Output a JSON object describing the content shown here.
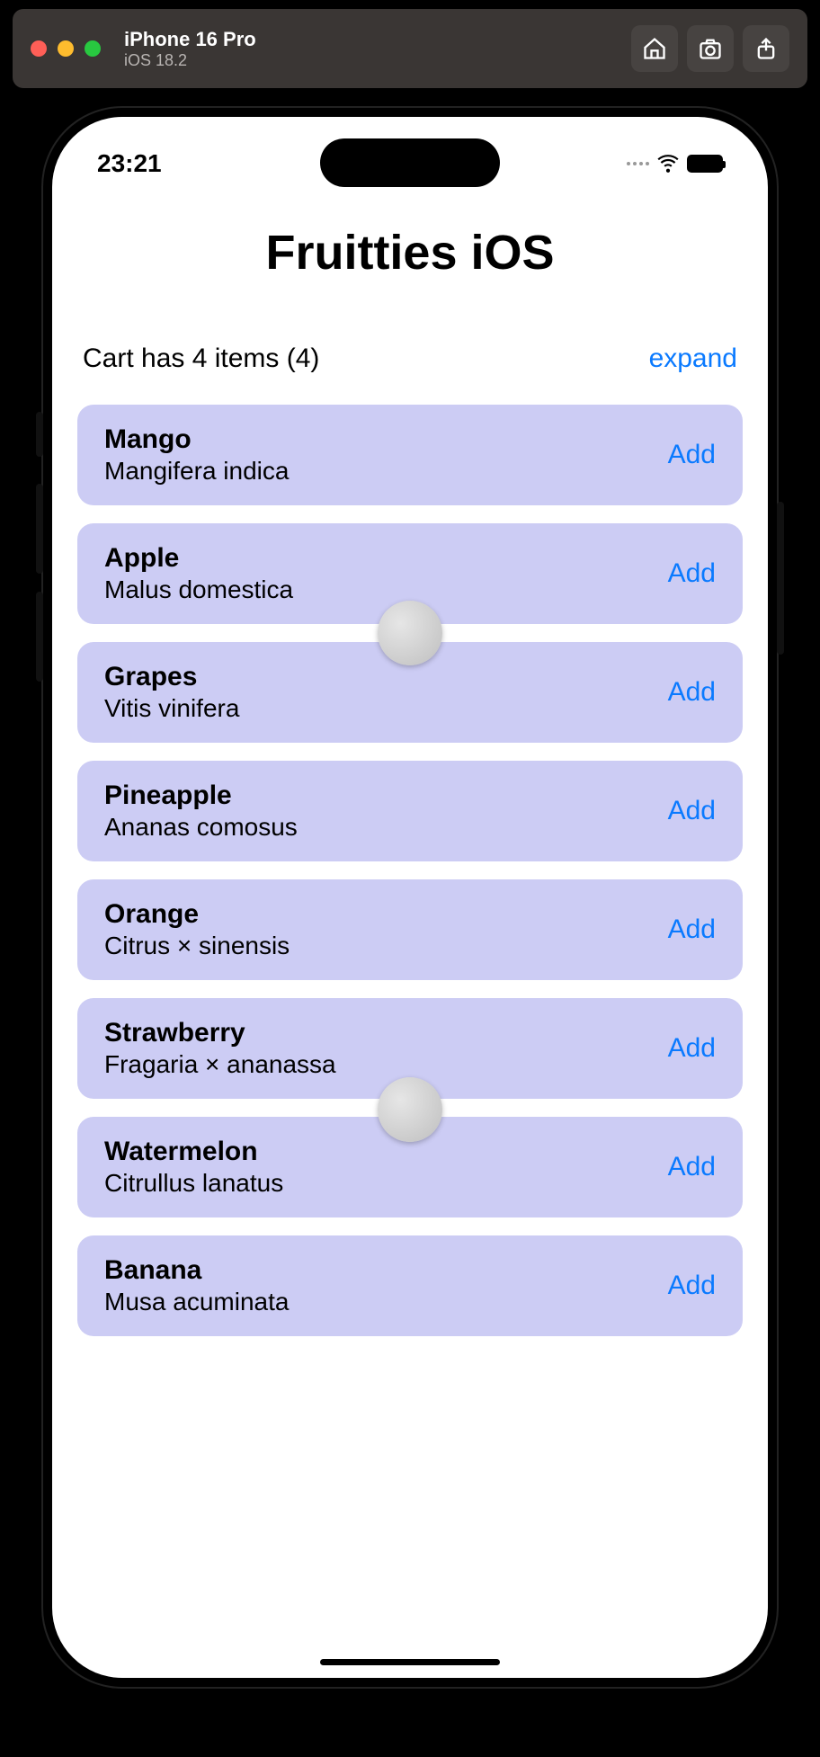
{
  "simulator": {
    "device": "iPhone 16 Pro",
    "os": "iOS 18.2"
  },
  "statusbar": {
    "time": "23:21"
  },
  "app": {
    "title": "Fruitties iOS"
  },
  "cart": {
    "label": "Cart has 4 items (4)",
    "expand": "expand"
  },
  "add_label": "Add",
  "fruits": [
    {
      "name": "Mango",
      "sci": "Mangifera indica"
    },
    {
      "name": "Apple",
      "sci": "Malus domestica"
    },
    {
      "name": "Grapes",
      "sci": "Vitis vinifera"
    },
    {
      "name": "Pineapple",
      "sci": "Ananas comosus"
    },
    {
      "name": "Orange",
      "sci": "Citrus × sinensis"
    },
    {
      "name": "Strawberry",
      "sci": "Fragaria × ananassa"
    },
    {
      "name": "Watermelon",
      "sci": "Citrullus lanatus"
    },
    {
      "name": "Banana",
      "sci": "Musa acuminata"
    }
  ]
}
